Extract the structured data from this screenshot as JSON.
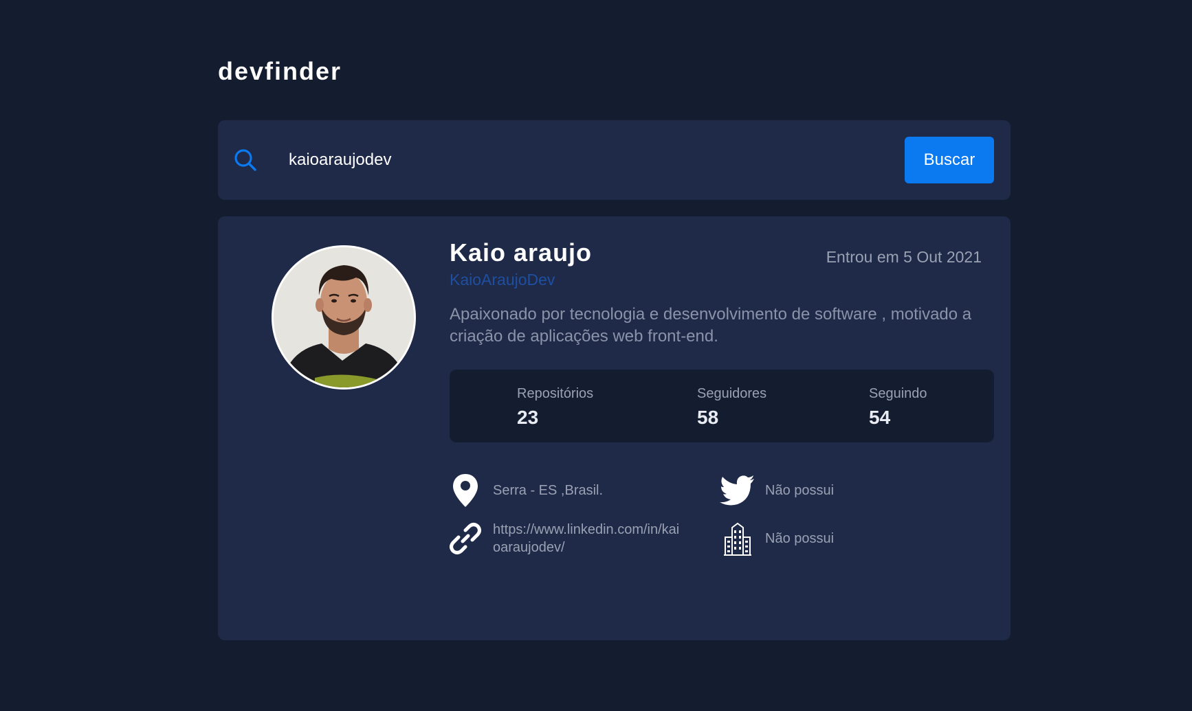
{
  "header": {
    "logo": "devfinder"
  },
  "search": {
    "value": "kaioaraujodev",
    "placeholder": "",
    "button_label": "Buscar"
  },
  "profile": {
    "name": "Kaio araujo",
    "login": "KaioAraujoDev",
    "joined": "Entrou em 5 Out 2021",
    "bio": "Apaixonado por tecnologia e desenvolvimento de software , motivado a criação de aplicações web front-end.",
    "stats": [
      {
        "label": "Repositórios",
        "value": "23"
      },
      {
        "label": "Seguidores",
        "value": "58"
      },
      {
        "label": "Seguindo",
        "value": "54"
      }
    ],
    "info": {
      "location": "Serra - ES ,Brasil.",
      "blog": "https://www.linkedin.com/in/kai oaraujodev/",
      "twitter": "Não possui",
      "company": "Não possui"
    }
  },
  "icons": {
    "search": "search-icon",
    "location": "location-pin-icon",
    "link": "link-icon",
    "twitter": "twitter-icon",
    "company": "building-icon"
  },
  "colors": {
    "background": "#141c2f",
    "card": "#1f2a48",
    "accent": "#0b79f0",
    "login_link": "#1f4fa0"
  }
}
